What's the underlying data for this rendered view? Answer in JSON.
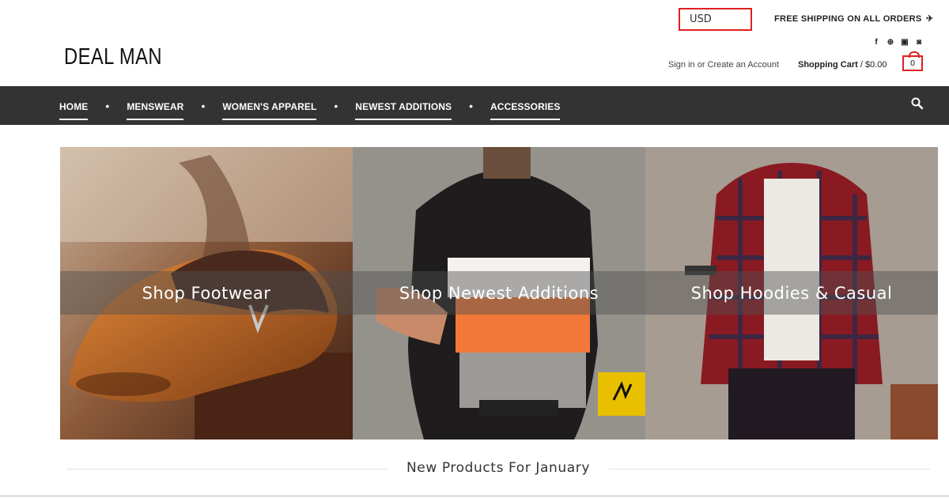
{
  "header": {
    "currency": "USD",
    "shipping": "FREE SHIPPING ON ALL ORDERS",
    "shipping_icon": "airplane-icon",
    "social": [
      {
        "name": "facebook-icon",
        "glyph": "f"
      },
      {
        "name": "pinterest-icon",
        "glyph": "℗"
      },
      {
        "name": "youtube-icon",
        "glyph": "▶"
      },
      {
        "name": "instagram-icon",
        "glyph": "◙"
      }
    ],
    "logo": "DEAL MAN",
    "sign_in": "Sign in",
    "or": "or",
    "create_account": "Create an Account",
    "cart_label": "Shopping Cart",
    "cart_sep": " / ",
    "cart_total": "$0.00",
    "cart_count": "0"
  },
  "nav": {
    "items": [
      "HOME",
      "MENSWEAR",
      "WOMEN'S APPAREL",
      "NEWEST ADDITIONS",
      "ACCESSORIES"
    ],
    "search_icon": "search-icon"
  },
  "tiles": [
    {
      "label": "Shop Footwear"
    },
    {
      "label": "Shop Newest Additions"
    },
    {
      "label": "Shop Hoodies & Casual"
    }
  ],
  "section": {
    "title": "New Products For January"
  },
  "colors": {
    "navbar": "#333333",
    "highlight": "#e02020"
  }
}
